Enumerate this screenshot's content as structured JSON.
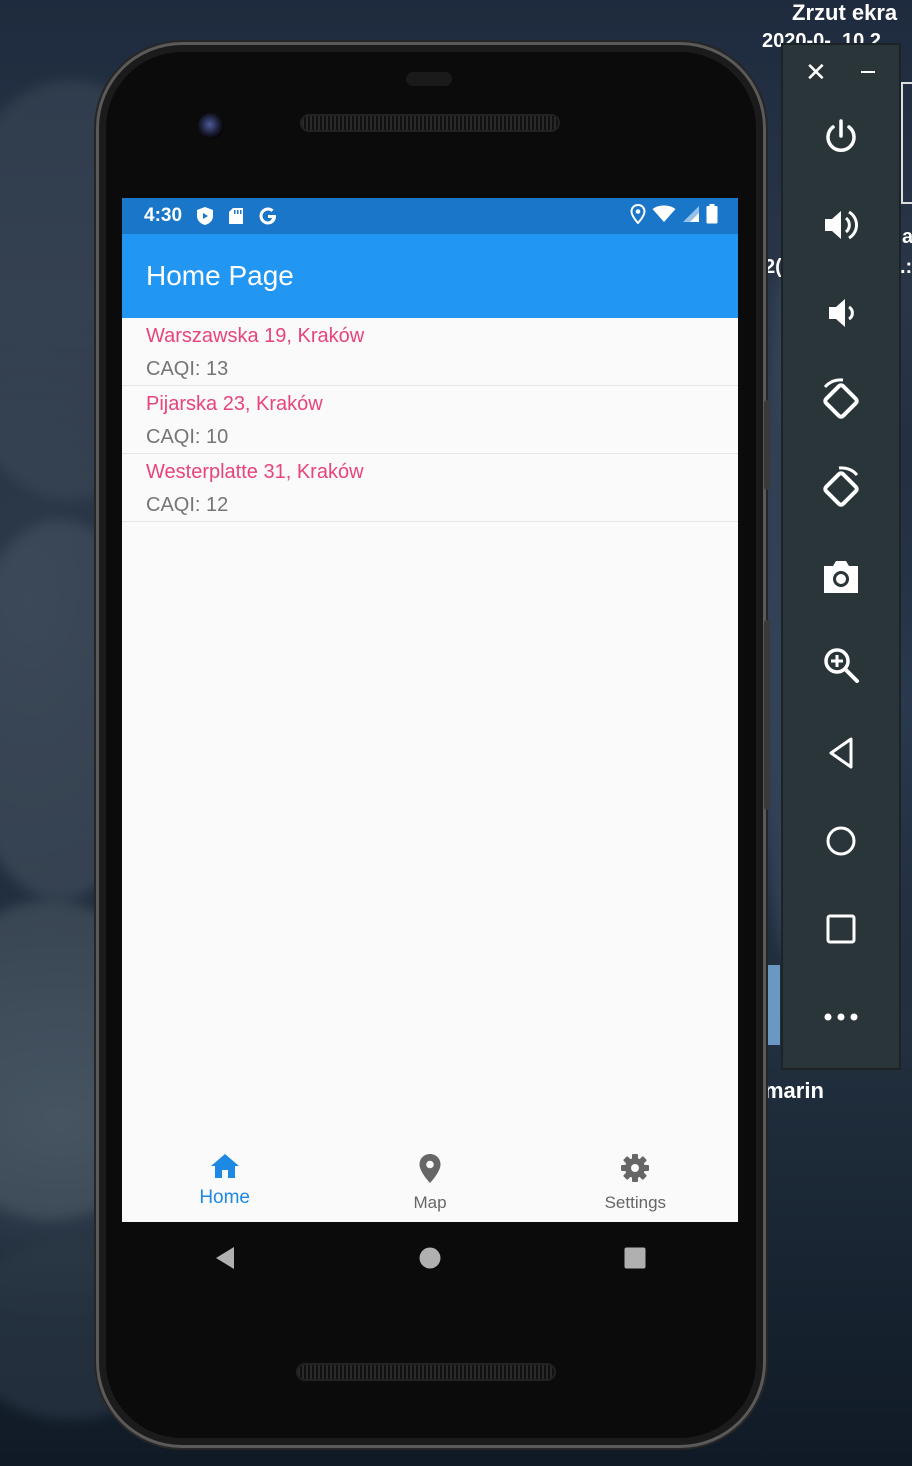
{
  "desktop": {
    "screenshot_label": "Zrzut ekra",
    "screenshot_label_2": "2020-0-_10.2",
    "side_text_a": "a",
    "side_text_2": "2(",
    "side_text_dot": ".:",
    "bottom_label": "marin"
  },
  "status_bar": {
    "time": "4:30",
    "left_icons": [
      "shield-icon",
      "sd-card-icon",
      "google-g-icon"
    ],
    "right_icons": [
      "location-icon",
      "wifi-icon",
      "signal-icon",
      "battery-icon"
    ]
  },
  "app_bar": {
    "title": "Home Page"
  },
  "stations": [
    {
      "address": "Warszawska 19, Kraków",
      "caqi": "CAQI: 13"
    },
    {
      "address": "Pijarska 23, Kraków",
      "caqi": "CAQI: 10"
    },
    {
      "address": "Westerplatte 31, Kraków",
      "caqi": "CAQI: 12"
    }
  ],
  "bottom_nav": {
    "items": [
      {
        "label": "Home",
        "icon": "home-icon",
        "active": true
      },
      {
        "label": "Map",
        "icon": "map-pin-icon",
        "active": false
      },
      {
        "label": "Settings",
        "icon": "gear-icon",
        "active": false
      }
    ]
  },
  "system_nav": [
    "back-icon",
    "home-circle-icon",
    "recents-icon"
  ],
  "emulator_toolbar": {
    "buttons": [
      "power-icon",
      "volume-up-icon",
      "volume-down-icon",
      "rotate-left-icon",
      "rotate-right-icon",
      "camera-icon",
      "zoom-icon",
      "back-icon",
      "home-icon",
      "overview-icon",
      "more-icon"
    ]
  },
  "colors": {
    "status_bar": "#1a76c9",
    "app_bar": "#2196f3",
    "accent_pink": "#e8437d",
    "active_nav": "#1e88e5"
  }
}
